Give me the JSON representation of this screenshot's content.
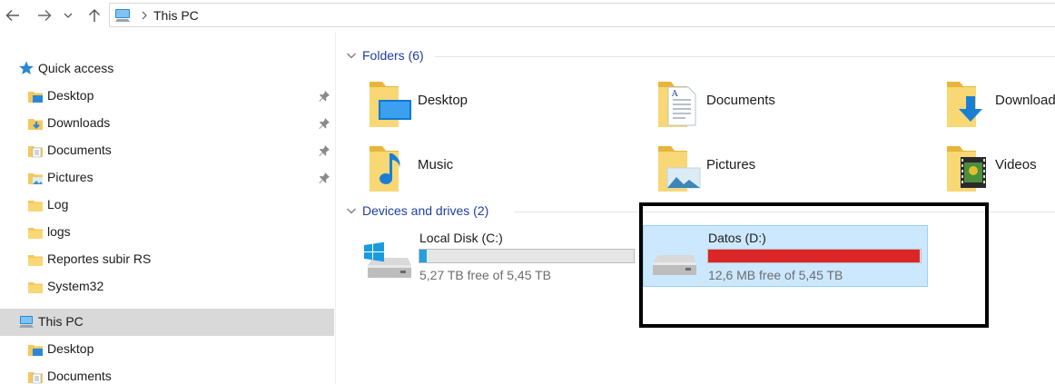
{
  "address": {
    "location": "This PC"
  },
  "sidebar": {
    "quick_access_label": "Quick access",
    "items": [
      {
        "label": "Desktop",
        "icon": "desktop-folder-icon",
        "pinned": true
      },
      {
        "label": "Downloads",
        "icon": "downloads-folder-icon",
        "pinned": true
      },
      {
        "label": "Documents",
        "icon": "documents-folder-icon",
        "pinned": true
      },
      {
        "label": "Pictures",
        "icon": "pictures-folder-icon",
        "pinned": true
      },
      {
        "label": "Log",
        "icon": "folder-icon",
        "pinned": false
      },
      {
        "label": "logs",
        "icon": "folder-icon",
        "pinned": false
      },
      {
        "label": "Reportes subir RS",
        "icon": "folder-icon",
        "pinned": false
      },
      {
        "label": "System32",
        "icon": "folder-icon",
        "pinned": false
      }
    ],
    "this_pc_label": "This PC",
    "this_pc_items": [
      {
        "label": "Desktop",
        "icon": "desktop-folder-icon"
      },
      {
        "label": "Documents",
        "icon": "documents-folder-icon"
      }
    ]
  },
  "folders": {
    "header": "Folders (6)",
    "items": [
      {
        "label": "Desktop",
        "icon": "desktop-folder-icon"
      },
      {
        "label": "Documents",
        "icon": "documents-folder-icon"
      },
      {
        "label": "Downloads",
        "icon": "downloads-folder-icon"
      },
      {
        "label": "Music",
        "icon": "music-folder-icon"
      },
      {
        "label": "Pictures",
        "icon": "pictures-folder-icon"
      },
      {
        "label": "Videos",
        "icon": "videos-folder-icon"
      }
    ]
  },
  "drives": {
    "header": "Devices and drives (2)",
    "items": [
      {
        "name": "Local Disk (C:)",
        "free_text": "5,27 TB free of 5,45 TB",
        "used_fraction": 0.033,
        "bar_color": "#26a0da",
        "selected": false,
        "icon": "windows-drive-icon"
      },
      {
        "name": "Datos (D:)",
        "free_text": "12,6 MB free of 5,45 TB",
        "used_fraction": 0.995,
        "bar_color": "#da2626",
        "selected": true,
        "icon": "hard-drive-icon"
      }
    ]
  },
  "colors": {
    "accent": "#26a0da",
    "full_drive": "#da2626",
    "selection_bg": "#cce8ff",
    "highlight_border": "#000000"
  }
}
